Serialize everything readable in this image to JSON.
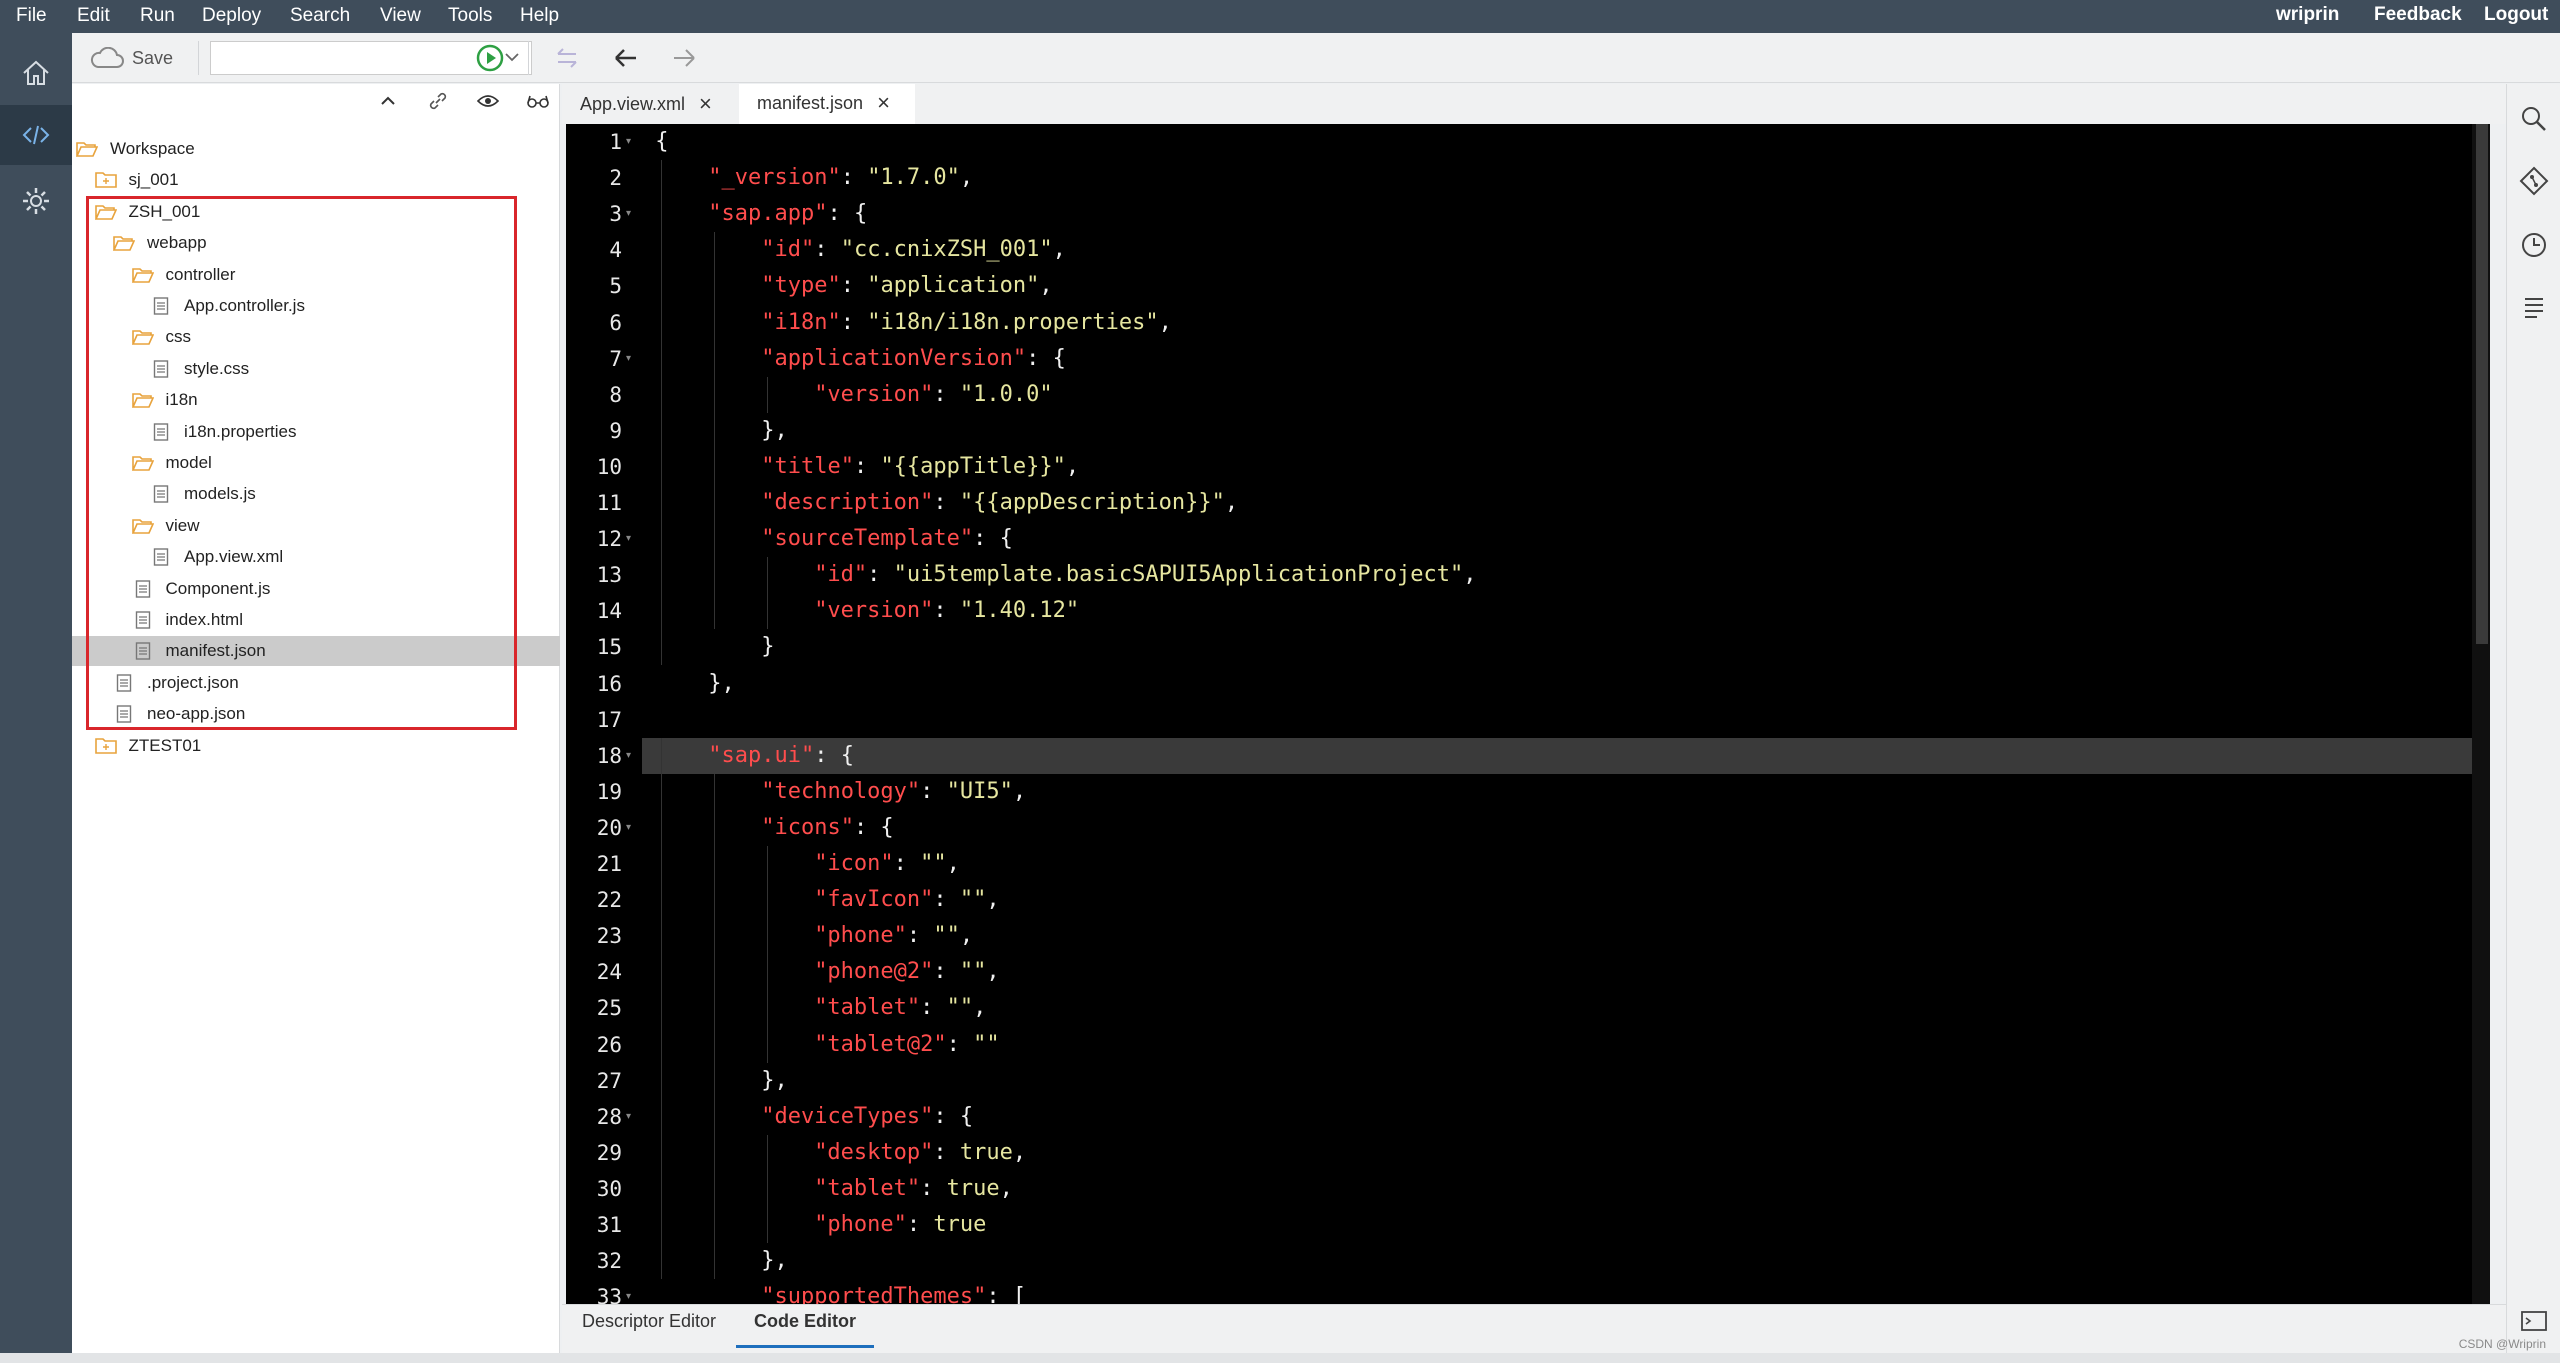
{
  "menu": [
    "File",
    "Edit",
    "Run",
    "Deploy",
    "Search",
    "View",
    "Tools",
    "Help"
  ],
  "header": {
    "user": "wriprin",
    "feedback": "Feedback",
    "logout": "Logout"
  },
  "toolbar": {
    "save": "Save"
  },
  "tabs": [
    {
      "label": "App.view.xml"
    },
    {
      "label": "manifest.json"
    }
  ],
  "bottom_tabs": [
    "Descriptor Editor",
    "Code Editor"
  ],
  "watermark": "CSDN @Wriprin",
  "tree": [
    {
      "label": "Workspace",
      "depth": 0,
      "icon": "folder-open-icon"
    },
    {
      "label": "sj_001",
      "depth": 1,
      "icon": "project-folder-icon"
    },
    {
      "label": "ZSH_001",
      "depth": 1,
      "icon": "folder-open-icon"
    },
    {
      "label": "webapp",
      "depth": 2,
      "icon": "folder-open-icon"
    },
    {
      "label": "controller",
      "depth": 3,
      "icon": "folder-open-icon"
    },
    {
      "label": "App.controller.js",
      "depth": 4,
      "icon": "file-icon"
    },
    {
      "label": "css",
      "depth": 3,
      "icon": "folder-open-icon"
    },
    {
      "label": "style.css",
      "depth": 4,
      "icon": "file-icon"
    },
    {
      "label": "i18n",
      "depth": 3,
      "icon": "folder-open-icon"
    },
    {
      "label": "i18n.properties",
      "depth": 4,
      "icon": "file-icon"
    },
    {
      "label": "model",
      "depth": 3,
      "icon": "folder-open-icon"
    },
    {
      "label": "models.js",
      "depth": 4,
      "icon": "file-icon"
    },
    {
      "label": "view",
      "depth": 3,
      "icon": "folder-open-icon"
    },
    {
      "label": "App.view.xml",
      "depth": 4,
      "icon": "file-icon"
    },
    {
      "label": "Component.js",
      "depth": 3,
      "icon": "file-icon"
    },
    {
      "label": "index.html",
      "depth": 3,
      "icon": "file-icon"
    },
    {
      "label": "manifest.json",
      "depth": 3,
      "icon": "file-icon",
      "selected": true
    },
    {
      "label": ".project.json",
      "depth": 2,
      "icon": "file-icon"
    },
    {
      "label": "neo-app.json",
      "depth": 2,
      "icon": "file-icon"
    },
    {
      "label": "ZTEST01",
      "depth": 1,
      "icon": "project-folder-icon"
    }
  ],
  "code": {
    "current_line": 18,
    "lines": [
      {
        "n": "1",
        "fold": true,
        "indent": 0,
        "key": "",
        "rest": "{"
      },
      {
        "n": "2",
        "fold": false,
        "indent": 1,
        "key": "\"_version\"",
        "rest": ": \"1.7.0\","
      },
      {
        "n": "3",
        "fold": true,
        "indent": 1,
        "key": "\"sap.app\"",
        "rest": ": {"
      },
      {
        "n": "4",
        "fold": false,
        "indent": 2,
        "key": "\"id\"",
        "rest": ": \"cc.cnixZSH_001\","
      },
      {
        "n": "5",
        "fold": false,
        "indent": 2,
        "key": "\"type\"",
        "rest": ": \"application\","
      },
      {
        "n": "6",
        "fold": false,
        "indent": 2,
        "key": "\"i18n\"",
        "rest": ": \"i18n/i18n.properties\","
      },
      {
        "n": "7",
        "fold": true,
        "indent": 2,
        "key": "\"applicationVersion\"",
        "rest": ": {"
      },
      {
        "n": "8",
        "fold": false,
        "indent": 3,
        "key": "\"version\"",
        "rest": ": \"1.0.0\""
      },
      {
        "n": "9",
        "fold": false,
        "indent": 2,
        "key": "",
        "rest": "},"
      },
      {
        "n": "10",
        "fold": false,
        "indent": 2,
        "key": "\"title\"",
        "rest": ": \"{{appTitle}}\","
      },
      {
        "n": "11",
        "fold": false,
        "indent": 2,
        "key": "\"description\"",
        "rest": ": \"{{appDescription}}\","
      },
      {
        "n": "12",
        "fold": true,
        "indent": 2,
        "key": "\"sourceTemplate\"",
        "rest": ": {"
      },
      {
        "n": "13",
        "fold": false,
        "indent": 3,
        "key": "\"id\"",
        "rest": ": \"ui5template.basicSAPUI5ApplicationProject\","
      },
      {
        "n": "14",
        "fold": false,
        "indent": 3,
        "key": "\"version\"",
        "rest": ": \"1.40.12\""
      },
      {
        "n": "15",
        "fold": false,
        "indent": 2,
        "key": "",
        "rest": "}"
      },
      {
        "n": "16",
        "fold": false,
        "indent": 1,
        "key": "",
        "rest": "},"
      },
      {
        "n": "17",
        "fold": false,
        "indent": 0,
        "key": "",
        "rest": ""
      },
      {
        "n": "18",
        "fold": true,
        "indent": 1,
        "key": "\"sap.ui\"",
        "rest": ": {"
      },
      {
        "n": "19",
        "fold": false,
        "indent": 2,
        "key": "\"technology\"",
        "rest": ": \"UI5\","
      },
      {
        "n": "20",
        "fold": true,
        "indent": 2,
        "key": "\"icons\"",
        "rest": ": {"
      },
      {
        "n": "21",
        "fold": false,
        "indent": 3,
        "key": "\"icon\"",
        "rest": ": \"\","
      },
      {
        "n": "22",
        "fold": false,
        "indent": 3,
        "key": "\"favIcon\"",
        "rest": ": \"\","
      },
      {
        "n": "23",
        "fold": false,
        "indent": 3,
        "key": "\"phone\"",
        "rest": ": \"\","
      },
      {
        "n": "24",
        "fold": false,
        "indent": 3,
        "key": "\"phone@2\"",
        "rest": ": \"\","
      },
      {
        "n": "25",
        "fold": false,
        "indent": 3,
        "key": "\"tablet\"",
        "rest": ": \"\","
      },
      {
        "n": "26",
        "fold": false,
        "indent": 3,
        "key": "\"tablet@2\"",
        "rest": ": \"\""
      },
      {
        "n": "27",
        "fold": false,
        "indent": 2,
        "key": "",
        "rest": "},"
      },
      {
        "n": "28",
        "fold": true,
        "indent": 2,
        "key": "\"deviceTypes\"",
        "rest": ": {"
      },
      {
        "n": "29",
        "fold": false,
        "indent": 3,
        "key": "\"desktop\"",
        "rest": ": true,"
      },
      {
        "n": "30",
        "fold": false,
        "indent": 3,
        "key": "\"tablet\"",
        "rest": ": true,"
      },
      {
        "n": "31",
        "fold": false,
        "indent": 3,
        "key": "\"phone\"",
        "rest": ": true"
      },
      {
        "n": "32",
        "fold": false,
        "indent": 2,
        "key": "",
        "rest": "},"
      },
      {
        "n": "33",
        "fold": true,
        "indent": 2,
        "key": "\"supportedThemes\"",
        "rest": ": ["
      }
    ]
  },
  "colors": {
    "key": "#ff4d4d",
    "string": "#e6e6a0",
    "menubar": "#3f4d5b",
    "highlight": "#d9262b"
  }
}
